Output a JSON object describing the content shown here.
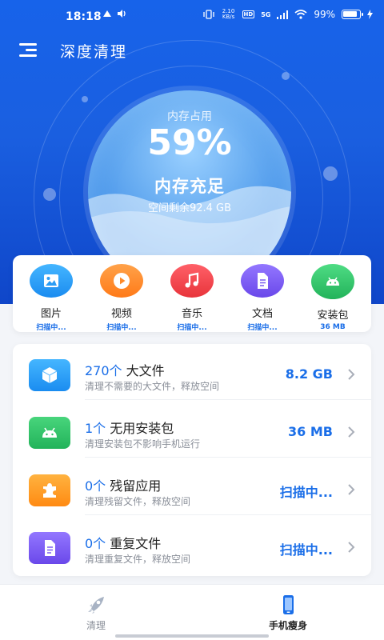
{
  "status_bar": {
    "time": "18:18",
    "net_speed": "2.10\nKB/s",
    "hd": "HD",
    "signal": "5G",
    "battery_pct": "99%"
  },
  "toolbar": {
    "title": "深度清理",
    "menu_icon": "menu-icon"
  },
  "gauge": {
    "caption": "内存占用",
    "percent": "59%",
    "status": "内存充足",
    "free_space": "空间剩余92.4 GB",
    "usage_fraction": 0.59
  },
  "categories": [
    {
      "name": "图片",
      "state": "扫描中...",
      "icon": "image-icon",
      "color": "#2a9cf5"
    },
    {
      "name": "视频",
      "state": "扫描中...",
      "icon": "play-icon",
      "color": "#ff8a2a"
    },
    {
      "name": "音乐",
      "state": "扫描中...",
      "icon": "music-icon",
      "color": "#f2454b"
    },
    {
      "name": "文档",
      "state": "扫描中...",
      "icon": "document-icon",
      "color": "#7b5cf0"
    },
    {
      "name": "安装包",
      "state": "36 MB",
      "icon": "android-icon",
      "color": "#34c66a"
    }
  ],
  "clean_items": [
    {
      "count": "270个",
      "title": "大文件",
      "desc": "清理不需要的大文件，释放空间",
      "value": "8.2 GB",
      "icon": "cube-icon",
      "color": "#2a9cf5"
    },
    {
      "count": "1个",
      "title": "无用安装包",
      "desc": "清理安装包不影响手机运行",
      "value": "36 MB",
      "icon": "android-icon",
      "color": "#2fbf66"
    },
    {
      "count": "0个",
      "title": "残留应用",
      "desc": "清理残留文件，释放空间",
      "value": "扫描中...",
      "icon": "puzzle-icon",
      "color": "#ff9a22"
    },
    {
      "count": "0个",
      "title": "重复文件",
      "desc": "清理重复文件，释放空间",
      "value": "扫描中...",
      "icon": "document-icon",
      "color": "#7b5cf0"
    }
  ],
  "bottom_nav": [
    {
      "label": "清理",
      "icon": "rocket-icon",
      "active": false
    },
    {
      "label": "手机瘦身",
      "icon": "phone-icon",
      "active": true
    }
  ],
  "colors": {
    "accent": "#1a6ee8",
    "header_blue": "#1763ea"
  }
}
